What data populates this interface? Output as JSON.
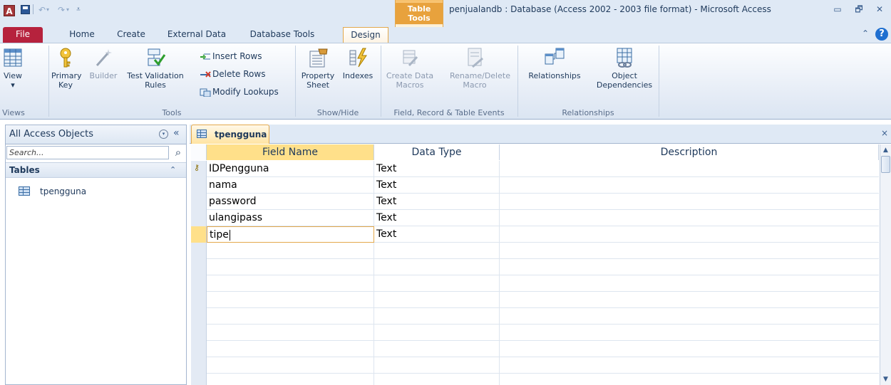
{
  "app": {
    "icon_letter": "A",
    "window_title": "penjualandb : Database (Access 2002 - 2003 file format)  -  Microsoft Access",
    "context_tab_header": "Table Tools"
  },
  "quick_access": {
    "save_icon": "save-icon",
    "undo_glyph": "↶",
    "redo_glyph": "↷",
    "dropdown_glyph": "▾",
    "customize_glyph": "⩡"
  },
  "window_controls": {
    "minimize": "▭",
    "restore": "🗗",
    "close": "✕"
  },
  "ribbon_tabs": [
    {
      "label": "File"
    },
    {
      "label": "Home"
    },
    {
      "label": "Create"
    },
    {
      "label": "External Data"
    },
    {
      "label": "Database Tools"
    },
    {
      "label": "Design"
    }
  ],
  "help": {
    "minimize_glyph": "⌃",
    "help_glyph": "?"
  },
  "ribbon": {
    "views": {
      "view_label": "View",
      "view_dd": "▾",
      "group_label": "Views"
    },
    "tools": {
      "primary_key": "Primary Key",
      "builder": "Builder",
      "test_validation": "Test Validation Rules",
      "insert_rows": "Insert Rows",
      "delete_rows": "Delete Rows",
      "modify_lookups": "Modify Lookups",
      "group_label": "Tools"
    },
    "show_hide": {
      "property_sheet": "Property Sheet",
      "indexes": "Indexes",
      "group_label": "Show/Hide"
    },
    "events": {
      "create_data_macros": "Create Data Macros",
      "rename_delete_macro": "Rename/Delete Macro",
      "group_label": "Field, Record & Table Events"
    },
    "relationships": {
      "relationships": "Relationships",
      "object_dependencies": "Object Dependencies",
      "group_label": "Relationships"
    }
  },
  "nav_pane": {
    "title": "All Access Objects",
    "dropdown_glyph": "▾",
    "collapse_glyph": "«",
    "search_placeholder": "Search...",
    "group_label": "Tables",
    "group_chevron": "⌃",
    "items": [
      {
        "label": "tpengguna"
      }
    ]
  },
  "document": {
    "tab_label": "tpengguna",
    "close_glyph": "×",
    "columns": {
      "field_name": "Field Name",
      "data_type": "Data Type",
      "description": "Description"
    },
    "rows": [
      {
        "field": "IDPengguna",
        "type": "Text",
        "primary_key": true
      },
      {
        "field": "nama",
        "type": "Text"
      },
      {
        "field": "password",
        "type": "Text"
      },
      {
        "field": "ulangipass",
        "type": "Text"
      },
      {
        "field": "tipe",
        "type": "Text",
        "editing": true
      }
    ],
    "empty_rows": 9
  },
  "colors": {
    "accent": "#b6223d",
    "context_tab": "#e8a23d",
    "selected_header": "#ffe08a",
    "ribbon_bg": "#dfe9f5"
  }
}
